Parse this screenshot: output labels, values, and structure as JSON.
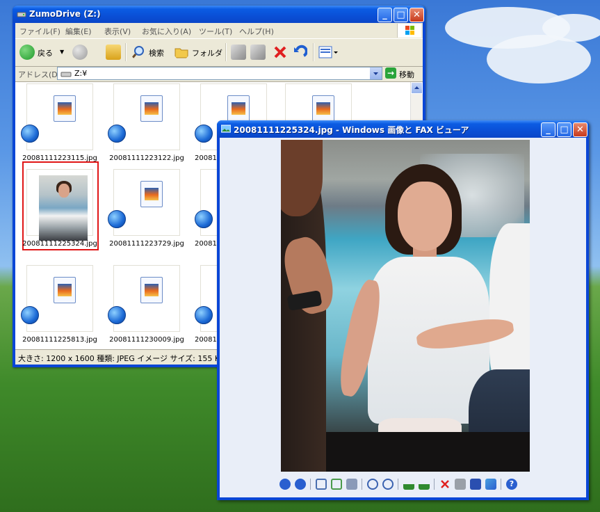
{
  "explorer": {
    "title": "ZumoDrive (Z:)",
    "menu": [
      "ファイル(F)",
      "編集(E)",
      "表示(V)",
      "お気に入り(A)",
      "ツール(T)",
      "ヘルプ(H)"
    ],
    "toolbar": {
      "back_label": "戻る",
      "search_label": "検索",
      "folders_label": "フォルダ"
    },
    "address": {
      "label": "アドレス(D)",
      "value": "Z:¥",
      "go_label": "移動"
    },
    "files": [
      {
        "name": "20081111223115.jpg",
        "type": "doc"
      },
      {
        "name": "20081111223122.jpg",
        "type": "doc"
      },
      {
        "name": "2008111",
        "type": "doc"
      },
      {
        "name": "",
        "type": "doc"
      },
      {
        "name": "20081111225324.jpg",
        "type": "photo",
        "selected": true
      },
      {
        "name": "20081111223729.jpg",
        "type": "doc"
      },
      {
        "name": "2008111",
        "type": "doc"
      },
      {
        "name": "20081111225813.jpg",
        "type": "doc"
      },
      {
        "name": "20081111230009.jpg",
        "type": "doc"
      },
      {
        "name": "2008111",
        "type": "doc"
      }
    ],
    "status": "大きさ: 1200 x 1600 種類: JPEG イメージ サイズ: 155 KB"
  },
  "viewer": {
    "title": "20081111225324.jpg - Windows 画像と FAX ビューア",
    "tools": [
      "prev-icon",
      "next-icon",
      "best-fit-icon",
      "actual-size-icon",
      "slideshow-icon",
      "zoom-in-icon",
      "zoom-out-icon",
      "rotate-cw-icon",
      "rotate-ccw-icon",
      "delete-icon",
      "print-icon",
      "save-icon",
      "edit-icon",
      "help-icon"
    ]
  },
  "colors": {
    "xp_blue": "#0a46d6",
    "selection_red": "#e01515",
    "close_red": "#c7391c"
  }
}
